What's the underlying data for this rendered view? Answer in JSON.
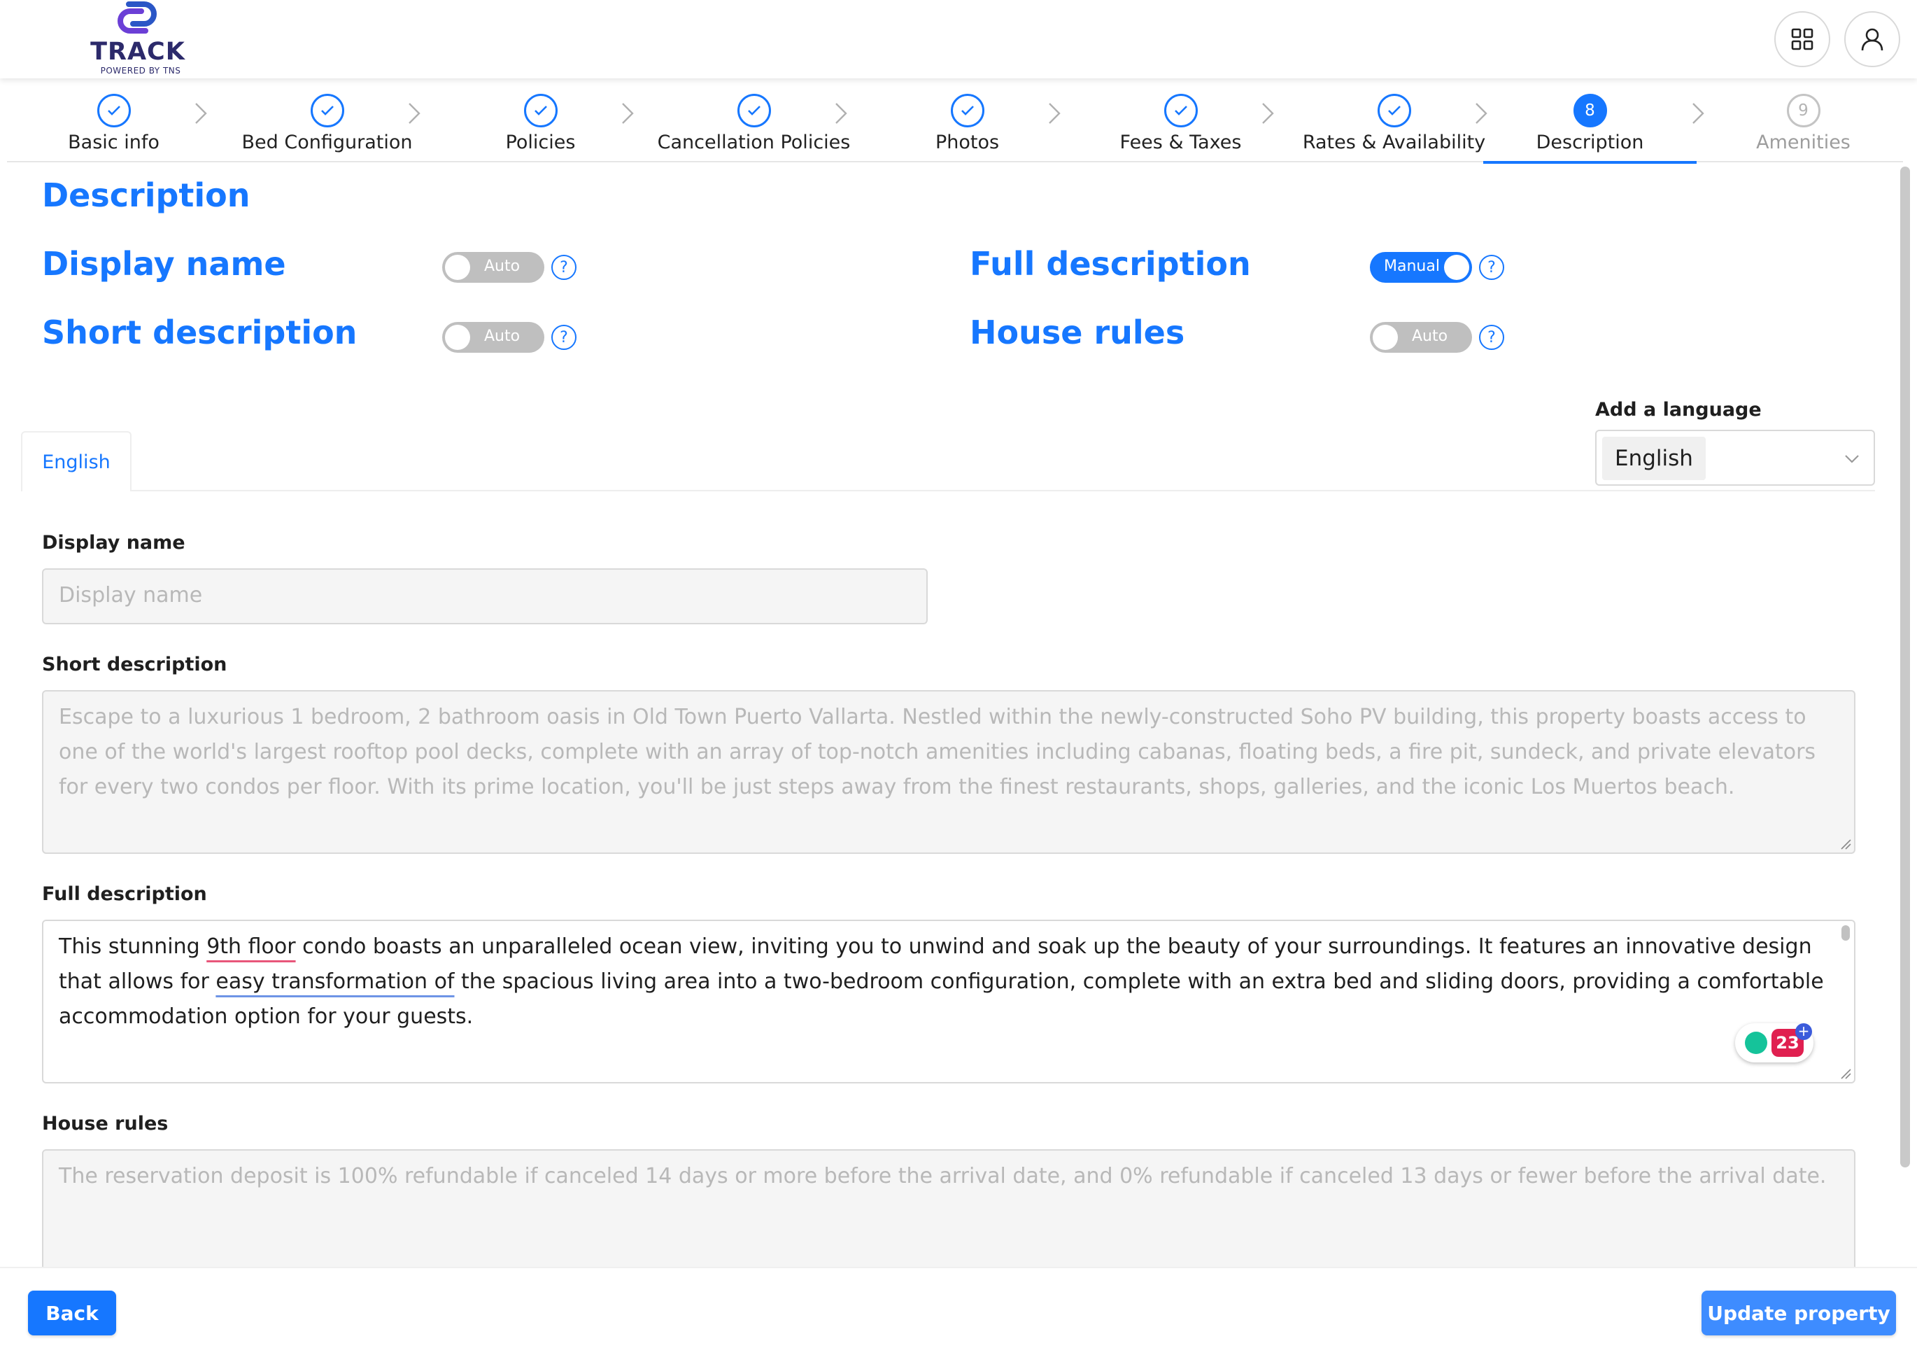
{
  "header": {
    "logo_text": "TRACK",
    "logo_sub": "POWERED BY TNS",
    "apps_icon": "grid-icon",
    "user_icon": "user-icon"
  },
  "steps": [
    {
      "label": "Basic info",
      "state": "done"
    },
    {
      "label": "Bed Configuration",
      "state": "done"
    },
    {
      "label": "Policies",
      "state": "done"
    },
    {
      "label": "Cancellation Policies",
      "state": "done"
    },
    {
      "label": "Photos",
      "state": "done"
    },
    {
      "label": "Fees & Taxes",
      "state": "done"
    },
    {
      "label": "Rates & Availability",
      "state": "done"
    },
    {
      "label": "Description",
      "state": "current",
      "number": "8"
    },
    {
      "label": "Amenities",
      "state": "pending",
      "number": "9"
    }
  ],
  "page": {
    "title": "Description"
  },
  "toggles": {
    "display_name": {
      "label": "Display name",
      "mode": "Auto"
    },
    "short_description": {
      "label": "Short description",
      "mode": "Auto"
    },
    "full_description": {
      "label": "Full description",
      "mode": "Manual"
    },
    "house_rules": {
      "label": "House rules",
      "mode": "Auto"
    },
    "help_glyph": "?"
  },
  "language": {
    "label": "Add a language",
    "selected": "English",
    "tab": "English"
  },
  "fields": {
    "display_name": {
      "label": "Display name",
      "placeholder": "Display name"
    },
    "short_description": {
      "label": "Short description",
      "value": "Escape to a luxurious 1 bedroom, 2 bathroom oasis in Old Town Puerto Vallarta. Nestled within the newly-constructed Soho PV building, this property boasts access to one of the world's largest rooftop pool decks, complete with an array of top-notch amenities including cabanas, floating beds, a fire pit, sundeck, and private elevators for every two condos per floor. With its prime location, you'll be just steps away from the finest restaurants, shops, galleries, and the iconic Los Muertos beach."
    },
    "full_description": {
      "label": "Full description",
      "part1": "This stunning ",
      "part2": "9th floor",
      "part3": " condo boasts an unparalleled ocean view, inviting you to unwind and soak up the beauty of your surroundings. It features an innovative design that allows for ",
      "part4": "easy transformation of",
      "part5": " the spacious living area into a two-bedroom configuration, complete with an extra bed and sliding doors, providing a comfortable accommodation option for your guests."
    },
    "house_rules": {
      "label": "House rules",
      "value": "The reservation deposit is 100% refundable if canceled 14 days or more before the arrival date, and 0% refundable if canceled 13 days or fewer before the arrival date."
    }
  },
  "grammar_widget": {
    "count": "23",
    "plus": "+"
  },
  "footer": {
    "back_label": "Back",
    "update_label": "Update property"
  },
  "colors": {
    "accent": "#1677ff",
    "grammar_red": "#e02050",
    "grammar_green": "#15c39a"
  }
}
